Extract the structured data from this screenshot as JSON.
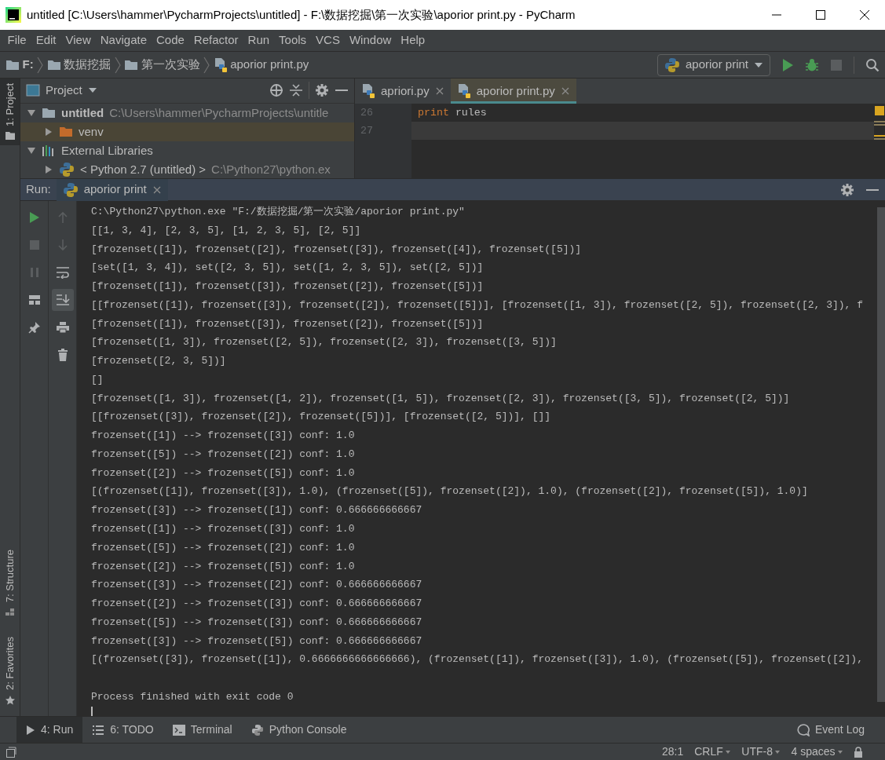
{
  "window": {
    "title": "untitled [C:\\Users\\hammer\\PycharmProjects\\untitled] - F:\\数据挖掘\\第一次实验\\aporior print.py - PyCharm"
  },
  "menu": [
    "File",
    "Edit",
    "View",
    "Navigate",
    "Code",
    "Refactor",
    "Run",
    "Tools",
    "VCS",
    "Window",
    "Help"
  ],
  "breadcrumb": [
    {
      "label": "F:",
      "kind": "folder"
    },
    {
      "label": "数据挖掘",
      "kind": "folder"
    },
    {
      "label": "第一次实验",
      "kind": "folder"
    },
    {
      "label": "aporior print.py",
      "kind": "file"
    }
  ],
  "run_config": {
    "label": "aporior print"
  },
  "left_tool_windows": [
    {
      "label": "1: Project",
      "selected": true
    },
    {
      "label": "7: Structure",
      "selected": false
    },
    {
      "label": "2: Favorites",
      "selected": false
    }
  ],
  "project": {
    "title": "Project",
    "tree": [
      {
        "label": "untitled",
        "path": "C:\\Users\\hammer\\PycharmProjects\\untitle",
        "kind": "module",
        "expanded": true,
        "selected": false,
        "children": [
          {
            "label": "venv",
            "kind": "folder",
            "expanded": false,
            "selected": true
          }
        ]
      },
      {
        "label": "External Libraries",
        "kind": "libraries",
        "expanded": true,
        "selected": false,
        "children": [
          {
            "label": "< Python 2.7 (untitled) >",
            "path": "C:\\Python27\\python.ex",
            "kind": "sdk",
            "expanded": false,
            "selected": false
          }
        ]
      }
    ]
  },
  "editor": {
    "tabs": [
      {
        "label": "apriori.py",
        "selected": false
      },
      {
        "label": "aporior print.py",
        "selected": true
      }
    ],
    "lines": [
      {
        "number": "26",
        "current": false,
        "tokens": [
          {
            "text": "print",
            "kind": "keyword"
          },
          {
            "text": " rules",
            "kind": "plain"
          }
        ]
      },
      {
        "number": "27",
        "current": true
      }
    ]
  },
  "run": {
    "title": "Run:",
    "tabs": [
      {
        "label": "aporior print",
        "selected": true
      }
    ],
    "scroll_to_end": true,
    "console": [
      "C:\\Python27\\python.exe \"F:/数据挖掘/第一次实验/aporior print.py\"",
      "[[1, 3, 4], [2, 3, 5], [1, 2, 3, 5], [2, 5]]",
      "[frozenset([1]), frozenset([2]), frozenset([3]), frozenset([4]), frozenset([5])]",
      "[set([1, 3, 4]), set([2, 3, 5]), set([1, 2, 3, 5]), set([2, 5])]",
      "[frozenset([1]), frozenset([3]), frozenset([2]), frozenset([5])]",
      "[[frozenset([1]), frozenset([3]), frozenset([2]), frozenset([5])], [frozenset([1, 3]), frozenset([2, 5]), frozenset([2, 3]), f",
      "[frozenset([1]), frozenset([3]), frozenset([2]), frozenset([5])]",
      "[frozenset([1, 3]), frozenset([2, 5]), frozenset([2, 3]), frozenset([3, 5])]",
      "[frozenset([2, 3, 5])]",
      "[]",
      "[frozenset([1, 3]), frozenset([1, 2]), frozenset([1, 5]), frozenset([2, 3]), frozenset([3, 5]), frozenset([2, 5])]",
      "[[frozenset([3]), frozenset([2]), frozenset([5])], [frozenset([2, 5])], []]",
      "frozenset([1]) --> frozenset([3]) conf: 1.0",
      "frozenset([5]) --> frozenset([2]) conf: 1.0",
      "frozenset([2]) --> frozenset([5]) conf: 1.0",
      "[(frozenset([1]), frozenset([3]), 1.0), (frozenset([5]), frozenset([2]), 1.0), (frozenset([2]), frozenset([5]), 1.0)]",
      "frozenset([3]) --> frozenset([1]) conf: 0.666666666667",
      "frozenset([1]) --> frozenset([3]) conf: 1.0",
      "frozenset([5]) --> frozenset([2]) conf: 1.0",
      "frozenset([2]) --> frozenset([5]) conf: 1.0",
      "frozenset([3]) --> frozenset([2]) conf: 0.666666666667",
      "frozenset([2]) --> frozenset([3]) conf: 0.666666666667",
      "frozenset([5]) --> frozenset([3]) conf: 0.666666666667",
      "frozenset([3]) --> frozenset([5]) conf: 0.666666666667",
      "[(frozenset([3]), frozenset([1]), 0.6666666666666666), (frozenset([1]), frozenset([3]), 1.0), (frozenset([5]), frozenset([2]),"
    ],
    "exit_message": "Process finished with exit code 0"
  },
  "bottom_tools": [
    {
      "label": "4: Run",
      "kind": "run",
      "selected": true
    },
    {
      "label": "6: TODO",
      "kind": "todo",
      "selected": false
    },
    {
      "label": "Terminal",
      "kind": "terminal",
      "selected": false
    },
    {
      "label": "Python Console",
      "kind": "python",
      "selected": false
    }
  ],
  "event_log": {
    "label": "Event Log"
  },
  "status_bar": [
    "28:1",
    "CRLF",
    "UTF-8",
    "4 spaces"
  ]
}
